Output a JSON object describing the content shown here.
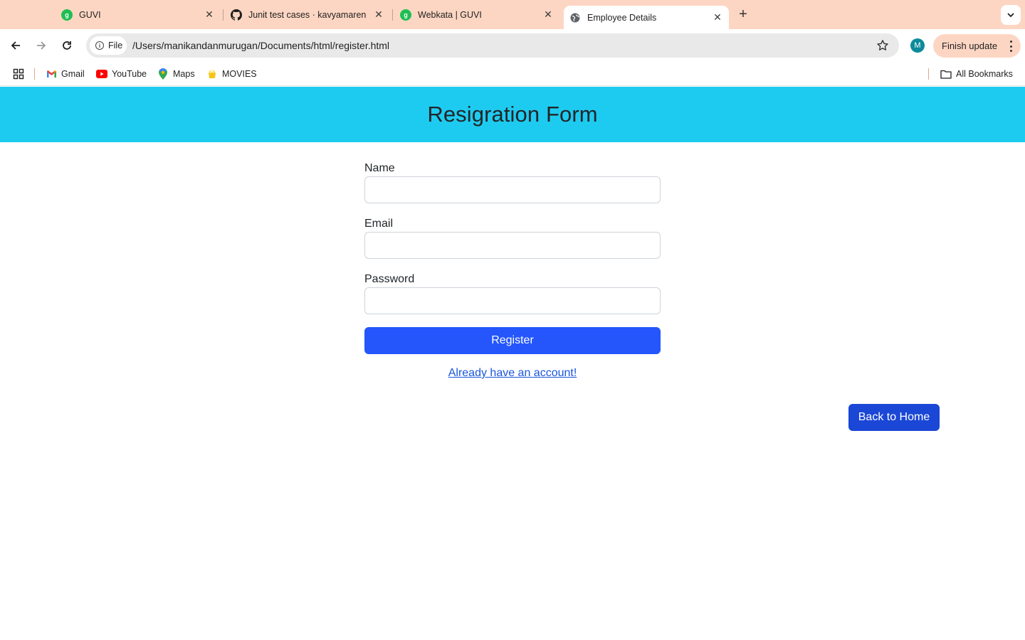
{
  "tabs": [
    {
      "title": "GUVI",
      "icon": "guvi-icon",
      "icon_text": "g"
    },
    {
      "title": "Junit test cases · kavyamaren",
      "icon": "github-icon"
    },
    {
      "title": "Webkata | GUVI",
      "icon": "guvi-icon",
      "icon_text": "g"
    },
    {
      "title": "Employee Details",
      "icon": "globe-icon",
      "active": true
    }
  ],
  "address_bar": {
    "scheme_chip": "File",
    "url": "/Users/manikandanmurugan/Documents/html/register.html"
  },
  "profile": {
    "initial": "M"
  },
  "finish_update": "Finish update",
  "bookmarks": {
    "items": [
      {
        "label": "Gmail",
        "icon": "gmail-icon"
      },
      {
        "label": "YouTube",
        "icon": "youtube-icon"
      },
      {
        "label": "Maps",
        "icon": "maps-icon"
      },
      {
        "label": "MOVIES",
        "icon": "movies-icon"
      }
    ],
    "all_bookmarks": "All Bookmarks"
  },
  "page": {
    "title": "Resigration Form",
    "form": {
      "name_label": "Name",
      "name_value": "",
      "email_label": "Email",
      "email_value": "",
      "password_label": "Password",
      "password_value": "",
      "register_button": "Register",
      "login_link": "Already have an account!"
    },
    "back_button": "Back to Home"
  },
  "colors": {
    "tabstrip": "#fdd6c3",
    "header": "#1ecbf0",
    "primary_button": "#2456fc",
    "back_button": "#1b47d6",
    "link": "#1a56db"
  }
}
